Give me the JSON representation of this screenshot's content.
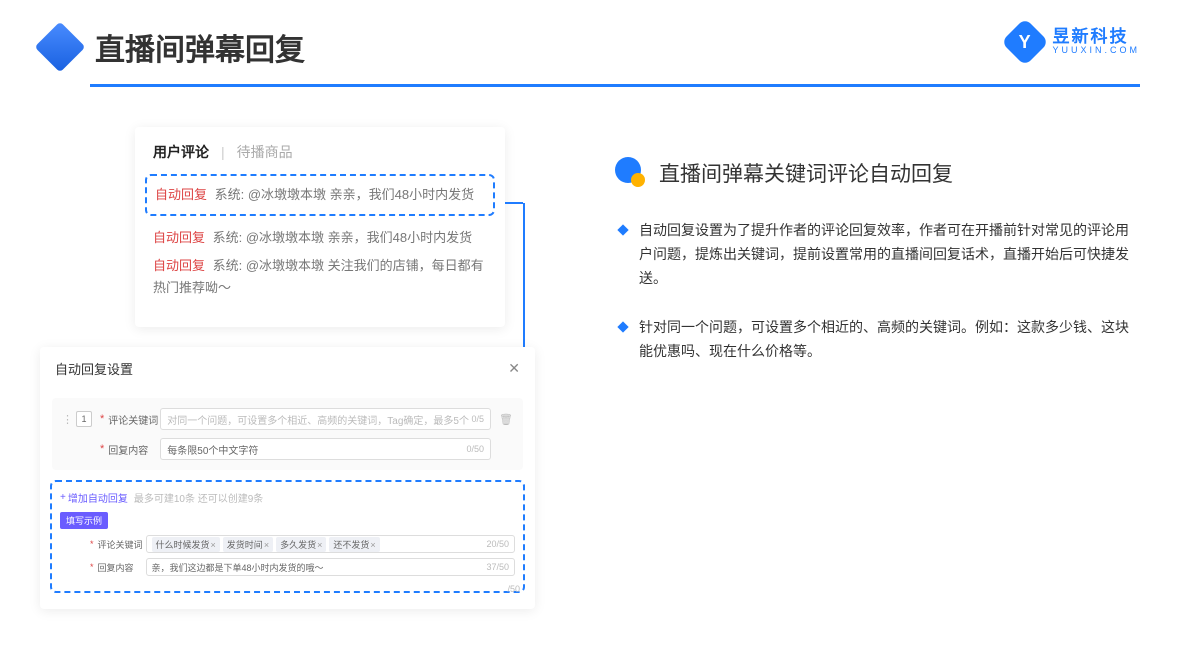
{
  "header": {
    "title": "直播间弹幕回复"
  },
  "brand": {
    "name": "昱新科技",
    "url": "YUUXIN.COM",
    "letter": "Y"
  },
  "comments": {
    "tabs": {
      "active": "用户评论",
      "inactive": "待播商品"
    },
    "tag_auto": "自动回复",
    "line1_sys": "系统: @冰墩墩本墩 亲亲，我们48小时内发货",
    "line2_sys": "系统: @冰墩墩本墩 亲亲，我们48小时内发货",
    "line3_sys": "系统: @冰墩墩本墩 关注我们的店铺，每日都有热门推荐呦～"
  },
  "settings": {
    "title": "自动回复设置",
    "row1_label": "评论关键词",
    "row1_placeholder": "对同一个问题，可设置多个相近、高频的关键词，Tag确定，最多5个",
    "row1_counter": "0/5",
    "row2_label": "回复内容",
    "row2_value": "每条限50个中文字符",
    "row2_counter": "0/50",
    "num1": "1",
    "add_text": "增加自动回复",
    "add_hint": "最多可建10条 还可以创建9条",
    "purple_badge": "填写示例",
    "ex1_label": "评论关键词",
    "ex1_tags": [
      "什么时候发货",
      "发货时间",
      "多久发货",
      "还不发货"
    ],
    "ex1_counter": "20/50",
    "ex2_label": "回复内容",
    "ex2_value": "亲，我们这边都是下单48小时内发货的哦～",
    "ex2_counter": "37/50",
    "side_counter": "/50"
  },
  "right": {
    "section_title": "直播间弹幕关键词评论自动回复",
    "bullet1": "自动回复设置为了提升作者的评论回复效率，作者可在开播前针对常见的评论用户问题，提炼出关键词，提前设置常用的直播间回复话术，直播开始后可快捷发送。",
    "bullet2": "针对同一个问题，可设置多个相近的、高频的关键词。例如：这款多少钱、这块能优惠吗、现在什么价格等。"
  }
}
